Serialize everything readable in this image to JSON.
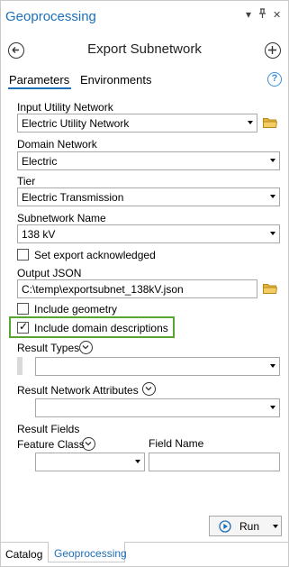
{
  "pane": {
    "title": "Geoprocessing",
    "pin_glyph": "⊥",
    "close_glyph": "✕",
    "menu_glyph": "▾"
  },
  "tool": {
    "title": "Export Subnetwork"
  },
  "tabs": [
    {
      "label": "Parameters"
    },
    {
      "label": "Environments"
    }
  ],
  "help_glyph": "?",
  "params": {
    "input_utility_network": {
      "label": "Input Utility Network",
      "value": "Electric Utility Network"
    },
    "domain_network": {
      "label": "Domain Network",
      "value": "Electric"
    },
    "tier": {
      "label": "Tier",
      "value": "Electric Transmission"
    },
    "subnetwork_name": {
      "label": "Subnetwork Name",
      "value": "138 kV"
    },
    "set_export_acknowledged": {
      "label": "Set export acknowledged",
      "checked": false
    },
    "output_json": {
      "label": "Output JSON",
      "value": "C:\\temp\\exportsubnet_138kV.json"
    },
    "include_geometry": {
      "label": "Include geometry",
      "checked": false
    },
    "include_domain_descriptions": {
      "label": "Include domain descriptions",
      "checked": true,
      "check_glyph": "✓"
    },
    "result_types": {
      "label": "Result Types",
      "value": ""
    },
    "result_network_attributes": {
      "label": "Result Network Attributes",
      "value": ""
    },
    "result_fields": {
      "label": "Result Fields",
      "feature_class_label": "Feature Class",
      "field_name_label": "Field Name",
      "feature_class_value": "",
      "field_name_value": ""
    }
  },
  "run_button": {
    "label": "Run"
  },
  "bottom_tabs": [
    {
      "label": "Catalog"
    },
    {
      "label": "Geoprocessing"
    }
  ],
  "colors": {
    "accent_blue": "#1d6fb8",
    "highlight_green": "#59a534",
    "run_icon_blue": "#1d6fb8",
    "folder_yellow": "#e7b53a"
  }
}
